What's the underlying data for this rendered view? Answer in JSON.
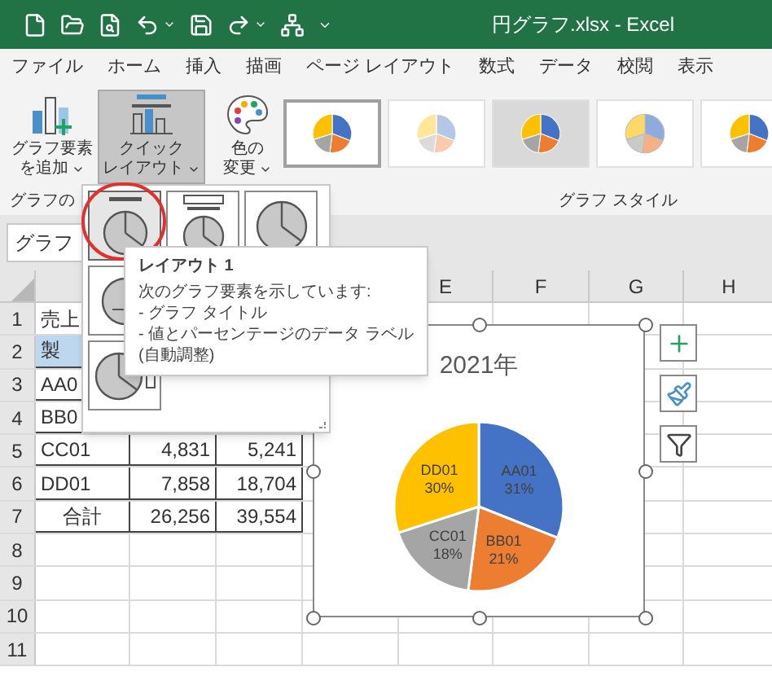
{
  "window": {
    "title": "円グラフ.xlsx - Excel"
  },
  "menu_tabs": [
    {
      "label": "ファイル"
    },
    {
      "label": "ホーム"
    },
    {
      "label": "挿入"
    },
    {
      "label": "描画"
    },
    {
      "label": "ページ レイアウト"
    },
    {
      "label": "数式"
    },
    {
      "label": "データ"
    },
    {
      "label": "校閲"
    },
    {
      "label": "表示"
    }
  ],
  "ribbon_buttons": [
    {
      "kind": "add-element",
      "lines": [
        "グラフ要素",
        "を追加"
      ],
      "selected": false
    },
    {
      "kind": "quick-layout",
      "lines": [
        "クイック",
        "レイアウト"
      ],
      "selected": true
    },
    {
      "kind": "colors",
      "lines": [
        "色の",
        "変更"
      ],
      "selected": false
    }
  ],
  "chart_styles": [
    {
      "kind": "plain",
      "selected": true
    },
    {
      "kind": "striped",
      "selected": false
    },
    {
      "kind": "shaded",
      "selected": false
    },
    {
      "kind": "pastel",
      "selected": false
    },
    {
      "kind": "plain",
      "selected": false
    }
  ],
  "groups": [
    {
      "label": "グラフの"
    },
    {
      "label": "グラフ スタイル"
    }
  ],
  "name_box": "グラフ",
  "columns": [
    "E",
    "F",
    "G",
    "H"
  ],
  "rows": [
    {
      "number": "1",
      "kind": "title",
      "cells": [
        "売上"
      ]
    },
    {
      "number": "2",
      "kind": "header",
      "cells": [
        "製"
      ]
    },
    {
      "number": "3",
      "kind": "data",
      "cells": [
        "AA0"
      ]
    },
    {
      "number": "4",
      "kind": "data",
      "cells": [
        "BB0"
      ]
    },
    {
      "number": "5",
      "kind": "data",
      "cells": [
        "CC01",
        "4,831",
        "5,241"
      ]
    },
    {
      "number": "6",
      "kind": "data",
      "cells": [
        "DD01",
        "7,858",
        "18,704"
      ]
    },
    {
      "number": "7",
      "kind": "total",
      "cells": [
        "合計",
        "26,256",
        "39,554"
      ]
    },
    {
      "number": "8",
      "kind": "empty",
      "cells": []
    },
    {
      "number": "9",
      "kind": "empty",
      "cells": []
    },
    {
      "number": "10",
      "kind": "empty",
      "cells": []
    },
    {
      "number": "11",
      "kind": "empty",
      "cells": []
    }
  ],
  "quick_layout_menu": {
    "layouts": [
      {
        "kind": "title-labels",
        "selected": true
      },
      {
        "kind": "title-legend-labels",
        "selected": false
      },
      {
        "kind": "plain",
        "selected": false
      },
      {
        "kind": "legend-bottom",
        "selected": false
      },
      {
        "kind": "legend-side",
        "selected": false
      }
    ]
  },
  "tooltip": {
    "title": "レイアウト 1",
    "lines": [
      "次のグラフ要素を示しています:",
      "- グラフ タイトル",
      "- 値とパーセンテージのデータ ラベル",
      "(自動調整)"
    ]
  },
  "chart": {
    "chart_data": {
      "type": "pie",
      "title": "2021年",
      "categories": [
        "AA01",
        "BB01",
        "CC01",
        "DD01"
      ],
      "values": [
        31,
        21,
        18,
        30
      ],
      "value_labels": [
        "31%",
        "21%",
        "18%",
        "30%"
      ]
    }
  },
  "chart_tools": [
    {
      "kind": "add"
    },
    {
      "kind": "style"
    },
    {
      "kind": "filter"
    }
  ]
}
